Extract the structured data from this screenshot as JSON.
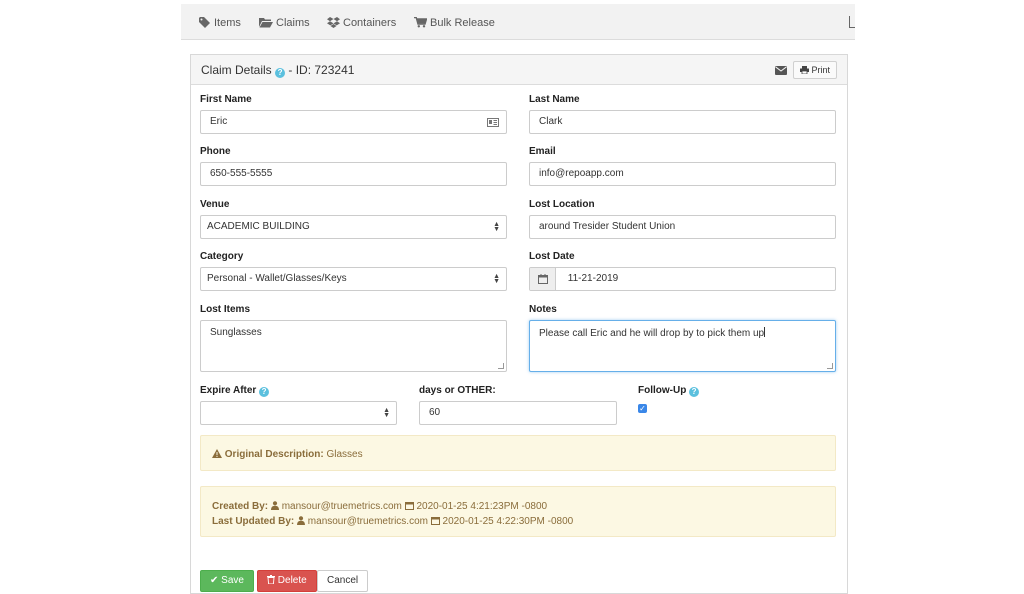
{
  "nav": {
    "items": [
      {
        "label": "Items",
        "icon": "tag-icon"
      },
      {
        "label": "Claims",
        "icon": "folder-icon"
      },
      {
        "label": "Containers",
        "icon": "dropbox-icon"
      },
      {
        "label": "Bulk Release",
        "icon": "cart-icon"
      }
    ]
  },
  "panel": {
    "title": "Claim Details",
    "id_text": "- ID: 723241",
    "print_label": "Print"
  },
  "form": {
    "first_name": {
      "label": "First Name",
      "value": "Eric"
    },
    "last_name": {
      "label": "Last Name",
      "value": "Clark"
    },
    "phone": {
      "label": "Phone",
      "value": "650-555-5555"
    },
    "email": {
      "label": "Email",
      "value": "info@repoapp.com"
    },
    "venue": {
      "label": "Venue",
      "value": "ACADEMIC BUILDING"
    },
    "lost_location": {
      "label": "Lost Location",
      "value": "around Tresider Student Union"
    },
    "category": {
      "label": "Category",
      "value": "Personal - Wallet/Glasses/Keys"
    },
    "lost_date": {
      "label": "Lost Date",
      "value": "11-21-2019"
    },
    "lost_items": {
      "label": "Lost Items",
      "value": "Sunglasses"
    },
    "notes": {
      "label": "Notes",
      "value": "Please call Eric and he will drop by to pick them up"
    },
    "expire_after": {
      "label": "Expire After",
      "value": ""
    },
    "days_other": {
      "label": "days or OTHER:",
      "value": "60"
    },
    "follow_up": {
      "label": "Follow-Up",
      "checked": true
    }
  },
  "original": {
    "label": "Original Description:",
    "value": "Glasses"
  },
  "audit": {
    "created_label": "Created By:",
    "created_user": "mansour@truemetrics.com",
    "created_time": "2020-01-25 4:21:23PM -0800",
    "updated_label": "Last Updated By:",
    "updated_user": "mansour@truemetrics.com",
    "updated_time": "2020-01-25 4:22:30PM -0800"
  },
  "actions": {
    "save": "Save",
    "delete": "Delete",
    "cancel": "Cancel"
  },
  "colors": {
    "save": "#5cb85c",
    "delete": "#d9534f",
    "alert_bg": "#fcf8e3",
    "help": "#5bc0de"
  }
}
